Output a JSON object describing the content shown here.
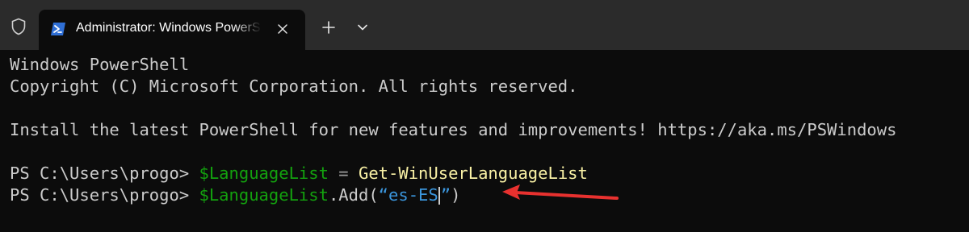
{
  "tab": {
    "title": "Administrator: Windows PowerShell"
  },
  "icons": {
    "shield": "shield-icon",
    "powershell": "powershell-icon",
    "close": "close-icon",
    "plus": "plus-icon",
    "chevron": "chevron-down-icon",
    "arrow": "red-arrow-annotation"
  },
  "terminal": {
    "line1": "Windows PowerShell",
    "line2": "Copyright (C) Microsoft Corporation. All rights reserved.",
    "line4": "Install the latest PowerShell for new features and improvements! https://aka.ms/PSWindows",
    "prompt": "PS C:\\Users\\progo> ",
    "cmd1": {
      "var": "$LanguageList",
      "op": " = ",
      "cmdlet": "Get-WinUserLanguageList"
    },
    "cmd2": {
      "var": "$LanguageList",
      "method": ".Add(",
      "string_before_cursor": "“es-ES",
      "string_after_cursor": "”",
      "close": ")"
    }
  },
  "colors": {
    "background": "#0c0c0c",
    "titlebar": "#2b2b2b",
    "variable": "#13a10e",
    "cmdlet": "#f9f1a5",
    "string": "#3b96dd",
    "arrow": "#e8312f"
  }
}
